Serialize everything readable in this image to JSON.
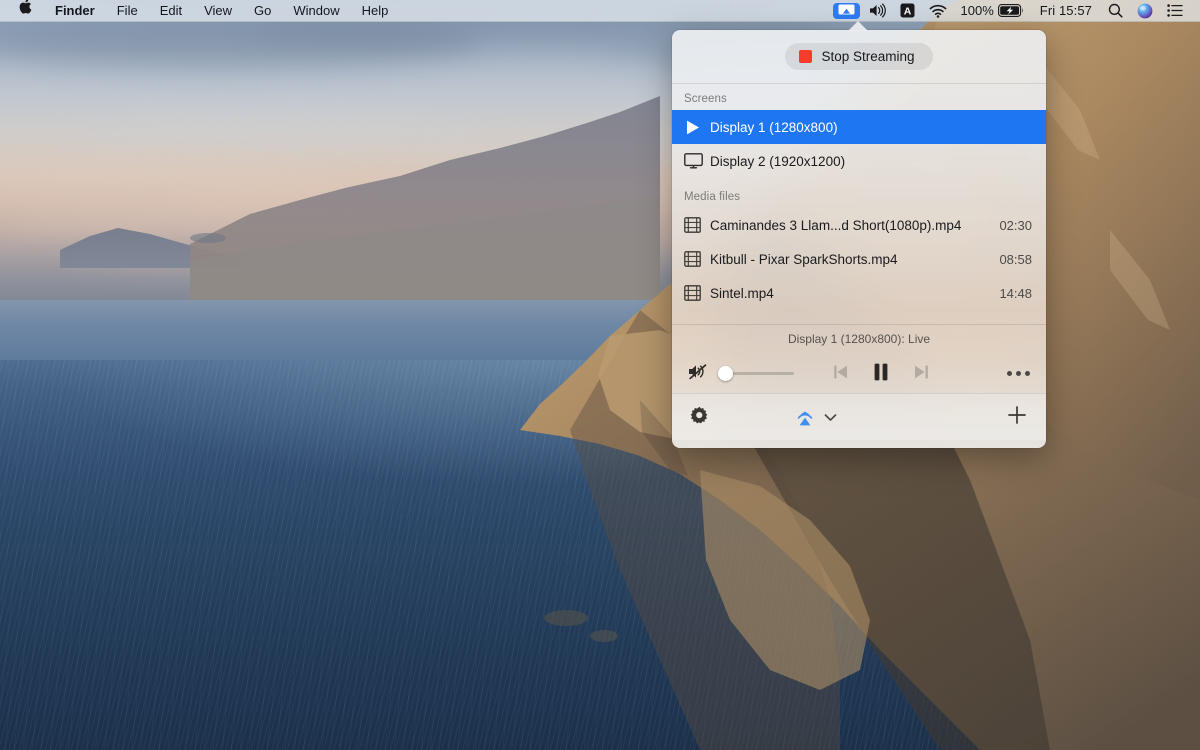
{
  "menubar": {
    "apple_icon": "apple-logo",
    "left_items": [
      {
        "label": "Finder",
        "bold": true
      },
      {
        "label": "File",
        "bold": false
      },
      {
        "label": "Edit",
        "bold": false
      },
      {
        "label": "View",
        "bold": false
      },
      {
        "label": "Go",
        "bold": false
      },
      {
        "label": "Window",
        "bold": false
      },
      {
        "label": "Help",
        "bold": false
      }
    ],
    "status_items": [
      {
        "name": "airplay-icon",
        "active": true
      },
      {
        "name": "volume-icon",
        "active": false
      },
      {
        "name": "input-source-icon",
        "label": "A",
        "active": false
      },
      {
        "name": "wifi-icon",
        "active": false
      }
    ],
    "battery_percent": "100%",
    "battery_state": "charging",
    "clock": "Fri 15:57",
    "spotlight_icon": "search-icon",
    "siri_icon": "siri-icon",
    "control_center_icon": "control-center-icon",
    "accent_color": "#2f7cf6"
  },
  "popover": {
    "stop_button": {
      "label": "Stop Streaming",
      "indicator_color": "#f73c2c"
    },
    "screens": {
      "section_label": "Screens",
      "items": [
        {
          "label": "Display 1 (1280x800)",
          "icon": "play-icon",
          "selected": true
        },
        {
          "label": "Display 2 (1920x1200)",
          "icon": "monitor-icon",
          "selected": false
        }
      ]
    },
    "media": {
      "section_label": "Media files",
      "items": [
        {
          "label": "Caminandes 3  Llam...d Short(1080p).mp4",
          "duration": "02:30",
          "icon": "film-icon"
        },
        {
          "label": "Kitbull - Pixar SparkShorts.mp4",
          "duration": "08:58",
          "icon": "film-icon"
        },
        {
          "label": "Sintel.mp4",
          "duration": "14:48",
          "icon": "film-icon"
        }
      ]
    },
    "player": {
      "status": "Display 1 (1280x800): Live",
      "mute_icon": "mute-icon",
      "volume_value": 0,
      "previous_icon": "previous-track-icon",
      "playpause_icon": "pause-icon",
      "next_icon": "next-track-icon",
      "more_icon": "more-options-icon"
    },
    "footer": {
      "settings_icon": "gear-icon",
      "airplay_icon": "airplay-icon",
      "airplay_chevron_icon": "chevron-down-icon",
      "add_icon": "plus-icon",
      "airplay_color": "#3f8ef0"
    },
    "selection_color": "#1f76f2"
  }
}
